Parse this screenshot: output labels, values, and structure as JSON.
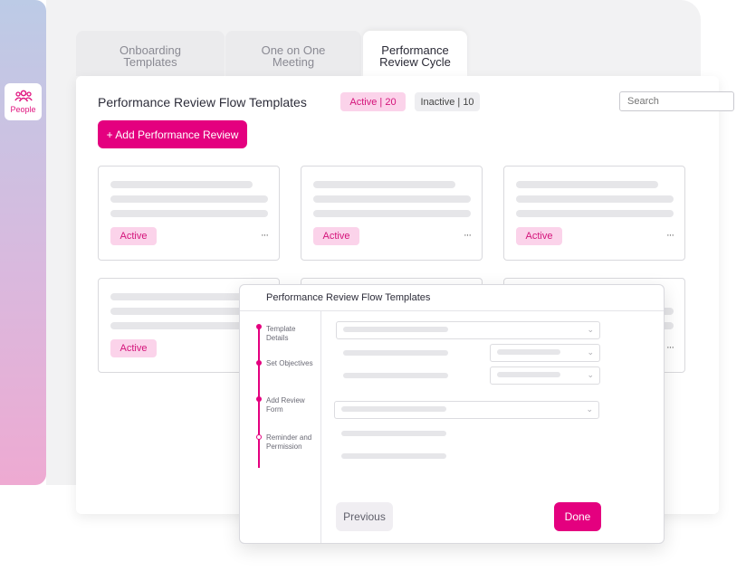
{
  "sidebar": {
    "people_label": "People",
    "people_icon": "people-icon"
  },
  "tabs": [
    {
      "label": "Onboarding Templates",
      "active": false
    },
    {
      "label": "One on One Meeting",
      "active": false
    },
    {
      "label": "Performance Review Cycle",
      "active": true
    }
  ],
  "main": {
    "title": "Performance Review Flow Templates",
    "active_pill": "Active | 20",
    "inactive_pill": "Inactive | 10",
    "search_placeholder": "Search",
    "add_button": "+ Add Performance Review",
    "cards": [
      {
        "status": "Active",
        "menu": "···"
      },
      {
        "status": "Active",
        "menu": "···"
      },
      {
        "status": "Active",
        "menu": "···"
      },
      {
        "status": "Active",
        "menu": "···"
      },
      {
        "status": "",
        "menu": ""
      },
      {
        "status": "",
        "menu": "···"
      }
    ]
  },
  "modal": {
    "title": "Performance Review Flow Templates",
    "steps": [
      {
        "label": "Template Details",
        "done": true
      },
      {
        "label": "Set Objectives",
        "done": true
      },
      {
        "label": "Add Review Form",
        "done": true
      },
      {
        "label": "Reminder and Permission",
        "done": false
      }
    ],
    "previous_button": "Previous",
    "done_button": "Done"
  },
  "colors": {
    "accent": "#e4007f",
    "pill_bg": "#fbd3ea",
    "sidebar_top": "#bccbe6",
    "sidebar_bottom": "#eeaad2"
  }
}
